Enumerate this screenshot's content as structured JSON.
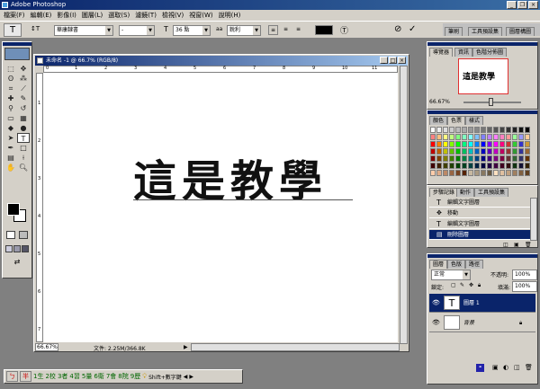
{
  "app": {
    "title": "Adobe Photoshop"
  },
  "menu": [
    "檔案(F)",
    "編輯(E)",
    "影像(I)",
    "圖層(L)",
    "選取(S)",
    "濾鏡(T)",
    "檢視(V)",
    "視窗(W)",
    "說明(H)"
  ],
  "options": {
    "tool_glyph": "T",
    "orient_glyph": "↕T",
    "font_family": "華康隸書",
    "font_style": "-",
    "size_label": "36 點",
    "aa_label": "銳利",
    "aa_value": "aa",
    "color": "#000000"
  },
  "top_tabs": [
    "筆刷",
    "工具預設集",
    "圖層構圖"
  ],
  "document": {
    "title": "未命名 -1 @ 66.7% (RGB/8)",
    "text": "這是教學",
    "ruler_top": [
      "0",
      "1",
      "2",
      "3",
      "4",
      "5",
      "6",
      "7",
      "8",
      "9",
      "10",
      "11"
    ],
    "ruler_left": [
      "1",
      "2",
      "3",
      "4",
      "5",
      "6",
      "7"
    ],
    "zoom": "66.67%",
    "file_info": "文件: 2.25M/366.8K"
  },
  "navigator": {
    "tabs": [
      "導覽器",
      "資訊",
      "色階分佈圖"
    ],
    "preview_text": "這是教學",
    "zoom": "66.67%"
  },
  "swatches": {
    "tabs": [
      "顏色",
      "色票",
      "樣式"
    ],
    "rows": [
      [
        "#ffffff",
        "#eeeeee",
        "#dddddd",
        "#cccccc",
        "#bbbbbb",
        "#aaaaaa",
        "#999999",
        "#888888",
        "#777777",
        "#666666",
        "#555555",
        "#444444",
        "#333333",
        "#222222",
        "#111111",
        "#000000"
      ],
      [
        "#ff8080",
        "#ffc080",
        "#ffff80",
        "#c0ff80",
        "#80ff80",
        "#80ffc0",
        "#80ffff",
        "#80c0ff",
        "#8080ff",
        "#c080ff",
        "#ff80ff",
        "#ff80c0",
        "#ff9999",
        "#99ff99",
        "#9999ff",
        "#ffcc99"
      ],
      [
        "#ff0000",
        "#ff8000",
        "#ffff00",
        "#80ff00",
        "#00ff00",
        "#00ff80",
        "#00ffff",
        "#0080ff",
        "#0000ff",
        "#8000ff",
        "#ff00ff",
        "#ff0080",
        "#cc3333",
        "#33cc33",
        "#3333cc",
        "#cc9933"
      ],
      [
        "#c00000",
        "#c06000",
        "#c0c000",
        "#60c000",
        "#00c000",
        "#00c060",
        "#00c0c0",
        "#0060c0",
        "#0000c0",
        "#6000c0",
        "#c000c0",
        "#c00060",
        "#993333",
        "#339933",
        "#333399",
        "#996633"
      ],
      [
        "#800000",
        "#804000",
        "#808000",
        "#408000",
        "#008000",
        "#008040",
        "#008080",
        "#004080",
        "#000080",
        "#400080",
        "#800080",
        "#800040",
        "#663333",
        "#336633",
        "#333366",
        "#663300"
      ],
      [
        "#400000",
        "#402000",
        "#404000",
        "#204000",
        "#004000",
        "#004020",
        "#004040",
        "#002040",
        "#000040",
        "#200040",
        "#400040",
        "#400020",
        "#331111",
        "#113311",
        "#111133",
        "#332200"
      ],
      [
        "#ffccaa",
        "#ddaa88",
        "#bb8866",
        "#996644",
        "#774422",
        "#552200",
        "#c8b8a0",
        "#a89880",
        "#887860",
        "#685840",
        "#ffe0c0",
        "#e0c0a0",
        "#c0a080",
        "#a08060",
        "#806040",
        "#604020"
      ]
    ]
  },
  "history": {
    "tabs": [
      "步驟記錄",
      "動作",
      "工具預設集"
    ],
    "items": [
      "編輯文字圖層",
      "移動",
      "編輯文字圖層",
      "刪除圖層"
    ]
  },
  "layers": {
    "tabs": [
      "圖層",
      "色版",
      "路徑"
    ],
    "mode": "正常",
    "opacity_label": "不透明:",
    "opacity": "100%",
    "lock_label": "鎖定:",
    "fill_label": "填滿:",
    "fill": "100%",
    "items": [
      {
        "name": "圖層 1",
        "thumb": "T"
      },
      {
        "name": "背景",
        "thumb": ""
      }
    ]
  },
  "ime": {
    "items": [
      "1生",
      "2校",
      "3者",
      "4習",
      "5量",
      "6衛",
      "7會",
      "8院",
      "9歷"
    ],
    "shift_label": "Shift+數字鍵"
  }
}
